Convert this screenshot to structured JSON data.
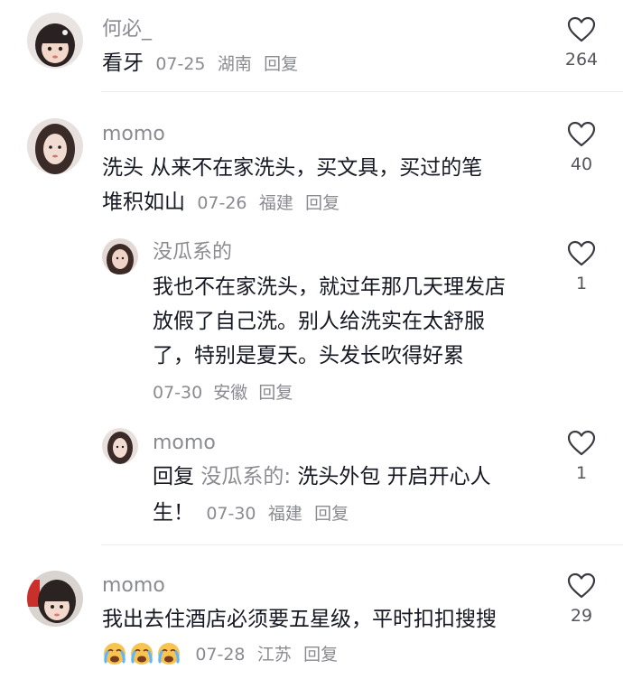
{
  "comments": [
    {
      "user": "何必_",
      "text": "看牙",
      "date": "07-25",
      "location": "湖南",
      "reply_label": "回复",
      "likes": "264"
    },
    {
      "user": "momo",
      "text_line1": "洗头 从来不在家洗头，买文具，买过的笔",
      "text_line2": "堆积如山",
      "date": "07-26",
      "location": "福建",
      "reply_label": "回复",
      "likes": "40",
      "replies": [
        {
          "user": "没瓜系的",
          "text_line1": "我也不在家洗头，就过年那几天理发店",
          "text_line2": "放假了自己洗。别人给洗实在太舒服",
          "text_line3": "了，特别是夏天。头发长吹得好累",
          "date": "07-30",
          "location": "安徽",
          "reply_label": "回复",
          "likes": "1"
        },
        {
          "user": "momo",
          "reply_prefix": "回复",
          "mention": "没瓜系的:",
          "text_line1_rest": "洗头外包 开启开心人",
          "text_line2": "生！",
          "date": "07-30",
          "location": "福建",
          "reply_label": "回复",
          "likes": "1"
        }
      ]
    },
    {
      "user": "momo",
      "text": "我出去住酒店必须要五星级，平时扣扣搜搜",
      "emoji_icons": [
        "crying-face-icon",
        "crying-face-icon",
        "crying-face-icon"
      ],
      "date": "07-28",
      "location": "江苏",
      "reply_label": "回复",
      "likes": "29"
    }
  ],
  "colors": {
    "primary_text": "#161823",
    "secondary_text": "#8a8b91",
    "divider": "#ececee"
  }
}
